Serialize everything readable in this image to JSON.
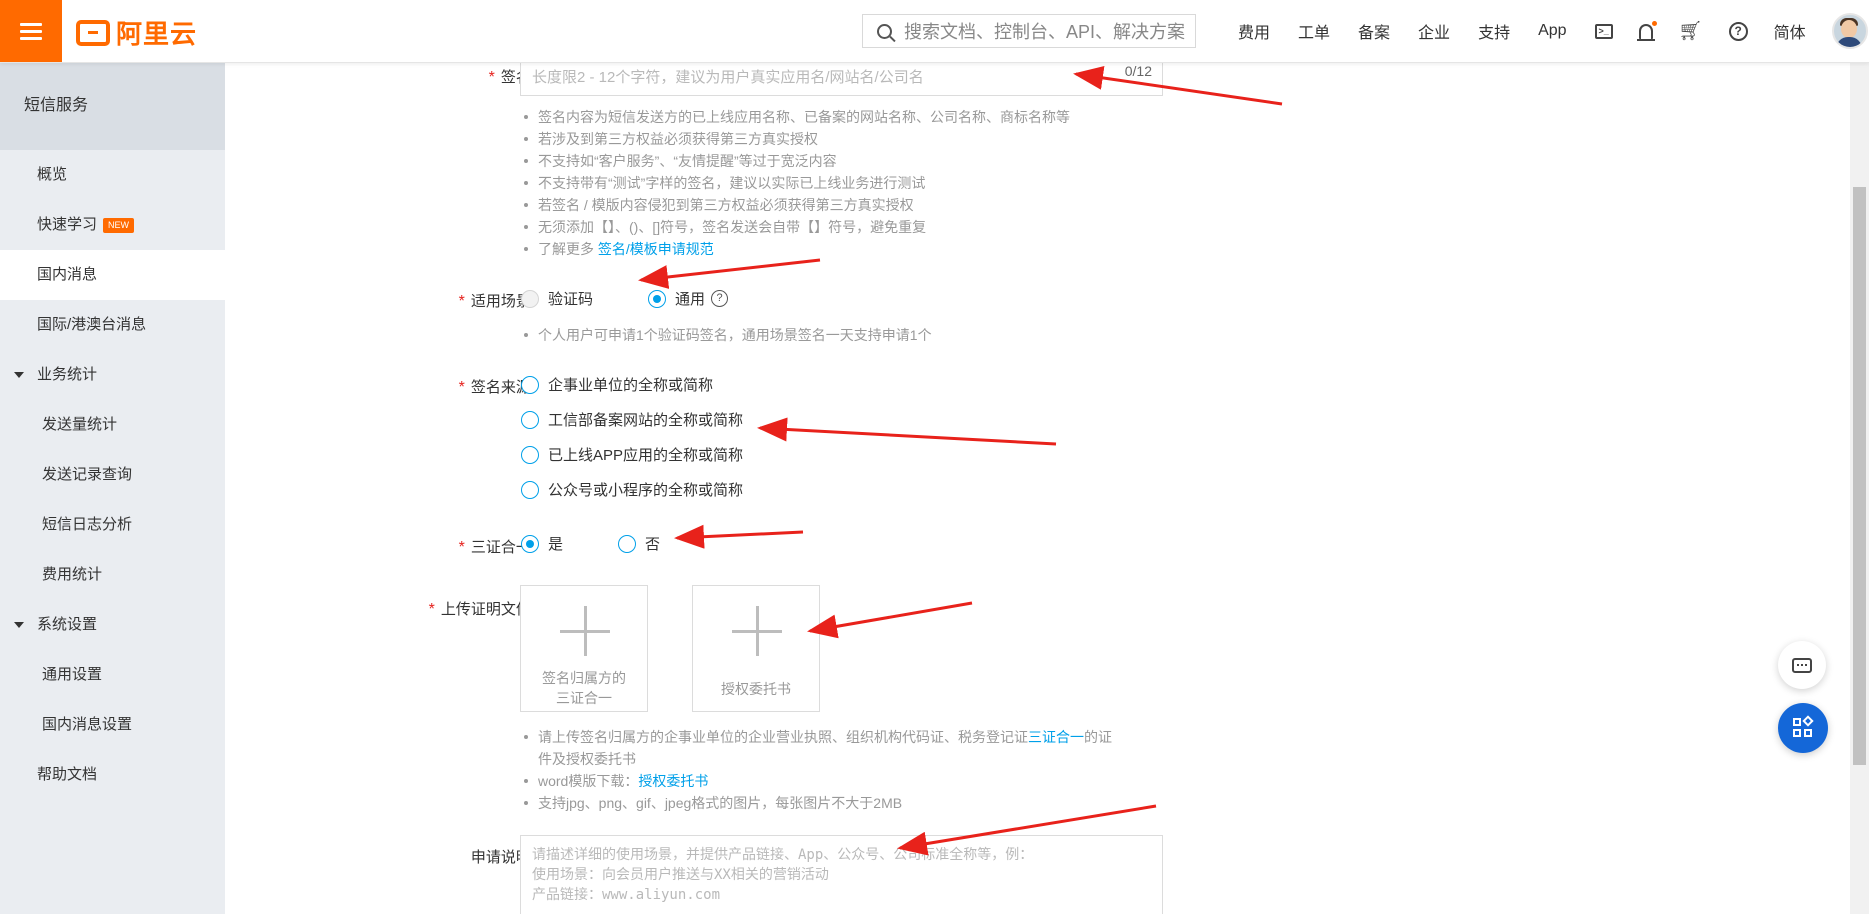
{
  "header": {
    "logo_text": "阿里云",
    "search_placeholder": "搜索文档、控制台、API、解决方案",
    "nav": [
      "费用",
      "工单",
      "备案",
      "企业",
      "支持",
      "App"
    ],
    "lang": "简体"
  },
  "sidebar": {
    "title": "短信服务",
    "items": {
      "overview": "概览",
      "quick_learn": "快速学习",
      "new_badge": "NEW",
      "domestic": "国内消息",
      "intl": "国际/港澳台消息",
      "stats_group": "业务统计",
      "send_stats": "发送量统计",
      "send_records": "发送记录查询",
      "log_analysis": "短信日志分析",
      "fee_stats": "费用统计",
      "settings_group": "系统设置",
      "general_settings": "通用设置",
      "domestic_settings": "国内消息设置",
      "help_docs": "帮助文档"
    }
  },
  "form": {
    "signature": {
      "label": "签名:",
      "placeholder": "长度限2 - 12个字符，建议为用户真实应用名/网站名/公司名",
      "counter": "0/12",
      "hints": [
        "签名内容为短信发送方的已上线应用名称、已备案的网站名称、公司名称、商标名称等",
        "若涉及到第三方权益必须获得第三方真实授权",
        "不支持如“客户服务”、“友情提醒”等过于宽泛内容",
        "不支持带有“测试”字样的签名，建议以实际已上线业务进行测试",
        "若签名 / 模版内容侵犯到第三方权益必须获得第三方真实授权",
        "无须添加【】、()、[]符号，签名发送会自带【】符号，避免重复"
      ],
      "more_prefix": "了解更多",
      "more_link": "签名/模板申请规范"
    },
    "scenario": {
      "label": "适用场景:",
      "option_code": "验证码",
      "option_general": "通用",
      "hint": "个人用户可申请1个验证码签名，通用场景签名一天支持申请1个"
    },
    "source": {
      "label": "签名来源:",
      "options": [
        "企事业单位的全称或简称",
        "工信部备案网站的全称或简称",
        "已上线APP应用的全称或简称",
        "公众号或小程序的全称或简称"
      ]
    },
    "three_in_one": {
      "label": "三证合一:",
      "yes": "是",
      "no": "否"
    },
    "upload": {
      "label": "上传证明文件:",
      "box1_line1": "签名归属方的",
      "box1_line2": "三证合一",
      "box2": "授权委托书",
      "hint1_a": "请上传签名归属方的企事业单位的企业营业执照、组织机构代码证、税务登记证",
      "hint1_link": "三证合一",
      "hint1_b": "的证",
      "hint1_c": "件及授权委托书",
      "hint2_prefix": "word模版下载：",
      "hint2_link": "授权委托书",
      "hint3": "支持jpg、png、gif、jpeg格式的图片，每张图片不大于2MB"
    },
    "description": {
      "label": "申请说明:",
      "ph_line1": "请描述详细的使用场景，并提供产品链接、App、公众号、公司标准全称等，例：",
      "ph_line2": "使用场景：向会员用户推送与XX相关的营销活动",
      "ph_line3": "产品链接：www.aliyun.com"
    }
  },
  "colors": {
    "brand": "#ff6a00",
    "link": "#00a0e9",
    "required": "#e5221e",
    "arrow": "#e8221b"
  }
}
